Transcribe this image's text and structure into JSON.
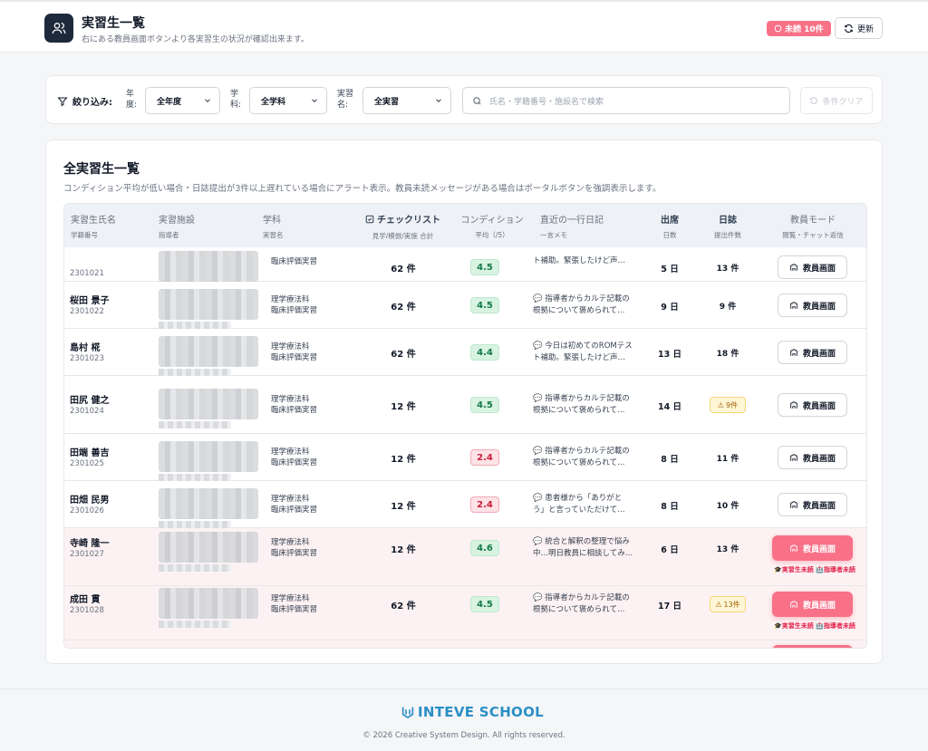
{
  "header": {
    "title": "実習生一覧",
    "subtitle": "右にある教員画面ボタンより各実習生の状況が確認出来ます。",
    "unread_badge": "未読 10件",
    "refresh_label": "更新"
  },
  "filter": {
    "label": "絞り込み:",
    "year_label": "年度:",
    "year_value": "全年度",
    "dept_label": "学科:",
    "dept_value": "全学科",
    "practice_label": "実習名:",
    "practice_value": "全実習",
    "search_placeholder": "氏名・学籍番号・施設名で検索",
    "clear_label": "条件クリア"
  },
  "card": {
    "title": "全実習生一覧",
    "description": "コンディション平均が低い場合・日誌提出が3件以上遅れている場合にアラート表示。教員未読メッセージがある場合はポータルボタンを強調表示します。"
  },
  "columns": [
    {
      "label": "実習生氏名",
      "sub": "学籍番号"
    },
    {
      "label": "実習施設",
      "sub": "指導者"
    },
    {
      "label": "学科",
      "sub": "実習名"
    },
    {
      "label": "チェックリスト",
      "sub": "見学/模倣/実施 合計"
    },
    {
      "label": "コンディション",
      "sub": "平均（/5）"
    },
    {
      "label": "直近の一行日記",
      "sub": "一言メモ"
    },
    {
      "label": "出席",
      "sub": "日数"
    },
    {
      "label": "日誌",
      "sub": "提出件数"
    },
    {
      "label": "教員モード",
      "sub": "閲覧・チャット返信"
    }
  ],
  "rows": [
    {
      "name": "",
      "id": "2301021",
      "dept": "",
      "practice": "臨床評価実習",
      "checklist": "62 件",
      "condition": "4.5",
      "cond_status": "ok",
      "diary1": "",
      "diary2": "ト補助。緊張したけど声…",
      "attendance": "5 日",
      "nisshi": "13 件",
      "warn": false,
      "alert": false,
      "teacher_btn": "教員画面",
      "tags": ""
    },
    {
      "name": "桜田 景子",
      "id": "2301022",
      "dept": "理学療法科",
      "practice": "臨床評価実習",
      "checklist": "62 件",
      "condition": "4.5",
      "cond_status": "ok",
      "diary1": "💬 指導者からカルテ記載の",
      "diary2": "根拠について褒められて…",
      "attendance": "9 日",
      "nisshi": "9 件",
      "warn": false,
      "alert": false,
      "teacher_btn": "教員画面",
      "tags": ""
    },
    {
      "name": "島村 椛",
      "id": "2301023",
      "dept": "理学療法科",
      "practice": "臨床評価実習",
      "checklist": "62 件",
      "condition": "4.4",
      "cond_status": "ok",
      "diary1": "💬 今日は初めてのROMテス",
      "diary2": "ト補助。緊張したけど声…",
      "attendance": "13 日",
      "nisshi": "18 件",
      "warn": false,
      "alert": false,
      "teacher_btn": "教員画面",
      "tags": ""
    },
    {
      "name": "田尻 健之",
      "id": "2301024",
      "dept": "理学療法科",
      "practice": "臨床評価実習",
      "checklist": "12 件",
      "condition": "4.5",
      "cond_status": "ok",
      "diary1": "💬 指導者からカルテ記載の",
      "diary2": "根拠について褒められて…",
      "attendance": "14 日",
      "nisshi": "9件",
      "warn": true,
      "alert": false,
      "teacher_btn": "教員画面",
      "tags": ""
    },
    {
      "name": "田端 善吉",
      "id": "2301025",
      "dept": "理学療法科",
      "practice": "臨床評価実習",
      "checklist": "12 件",
      "condition": "2.4",
      "cond_status": "ng",
      "diary1": "💬 指導者からカルテ記載の",
      "diary2": "根拠について褒められて…",
      "attendance": "8 日",
      "nisshi": "11 件",
      "warn": false,
      "alert": false,
      "teacher_btn": "教員画面",
      "tags": ""
    },
    {
      "name": "田畑 民男",
      "id": "2301026",
      "dept": "理学療法科",
      "practice": "臨床評価実習",
      "checklist": "12 件",
      "condition": "2.4",
      "cond_status": "ng",
      "diary1": "💬 患者様から「ありがと",
      "diary2": "う」と言っていただけて…",
      "attendance": "8 日",
      "nisshi": "10 件",
      "warn": false,
      "alert": false,
      "teacher_btn": "教員画面",
      "tags": ""
    },
    {
      "name": "寺崎 隆一",
      "id": "2301027",
      "dept": "理学療法科",
      "practice": "臨床評価実習",
      "checklist": "12 件",
      "condition": "4.6",
      "cond_status": "ok",
      "diary1": "💬 統合と解釈の整理で悩み",
      "diary2": "中…明日教員に相談してみ…",
      "attendance": "6 日",
      "nisshi": "13 件",
      "warn": false,
      "alert": true,
      "teacher_btn": "教員画面",
      "tags": "🎓実習生未読 🏥指導者未読"
    },
    {
      "name": "成田 貫",
      "id": "2301028",
      "dept": "理学療法科",
      "practice": "臨床評価実習",
      "checklist": "62 件",
      "condition": "4.5",
      "cond_status": "ok",
      "diary1": "💬 指導者からカルテ記載の",
      "diary2": "根拠について褒められて…",
      "attendance": "17 日",
      "nisshi": "13件",
      "warn": true,
      "alert": true,
      "teacher_btn": "教員画面",
      "tags": "🎓実習生未読 🏥指導者未読"
    }
  ],
  "footer": {
    "logo": "INTEVE SCHOOL",
    "copyright": "© 2026 Creative System Design. All rights reserved."
  },
  "colors": {
    "accent": "#f87187",
    "dark": "#1e293b",
    "ok": "#d8f3e2",
    "ng": "#fde2e6"
  }
}
